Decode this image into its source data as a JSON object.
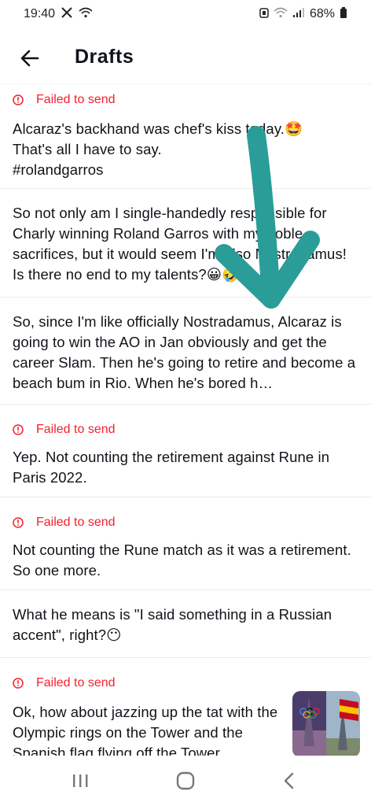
{
  "status": {
    "time": "19:40",
    "battery": "68%"
  },
  "header": {
    "title": "Drafts"
  },
  "drafts": [
    {
      "failed": true,
      "failed_label": "Failed to send",
      "text": "Alcaraz's backhand was chef's kiss today.🤩\nThat's all I have to say.\n#rolandgarros"
    },
    {
      "failed": false,
      "text": "So not only am I single-handedly responsible for Charly winning Roland Garros with my noble sacrifices, but it would seem I'm also Nostradamus! Is there no end to my talents?😀🤣…"
    },
    {
      "failed": false,
      "text": "So, since I'm like officially Nostradamus, Alcaraz is going to win the AO in Jan obviously and get the career Slam. Then he's going to retire and become a beach bum in Rio. When he's bored h…"
    },
    {
      "failed": true,
      "failed_label": "Failed to send",
      "text": "Yep. Not counting the retirement against Rune in Paris 2022."
    },
    {
      "failed": true,
      "failed_label": "Failed to send",
      "text": "Not counting the Rune match as it was a retirement. So one more."
    },
    {
      "failed": false,
      "text": "What he means is \"I said something in a Russian accent\", right?😶"
    },
    {
      "failed": true,
      "failed_label": "Failed to send",
      "text": "Ok, how about jazzing up the tat with the Olympic rings on the Tower and the Spanish flag flying off the Tower"
    }
  ],
  "colors": {
    "failed": "#f4212e",
    "arrow": "#2a9d99",
    "divider": "#e6ecf0"
  },
  "icons": {
    "back": "arrow-left-icon",
    "failed": "alert-circle-icon",
    "nav_recents": "recents-icon",
    "nav_home": "home-icon",
    "nav_back": "back-chevron-icon"
  }
}
